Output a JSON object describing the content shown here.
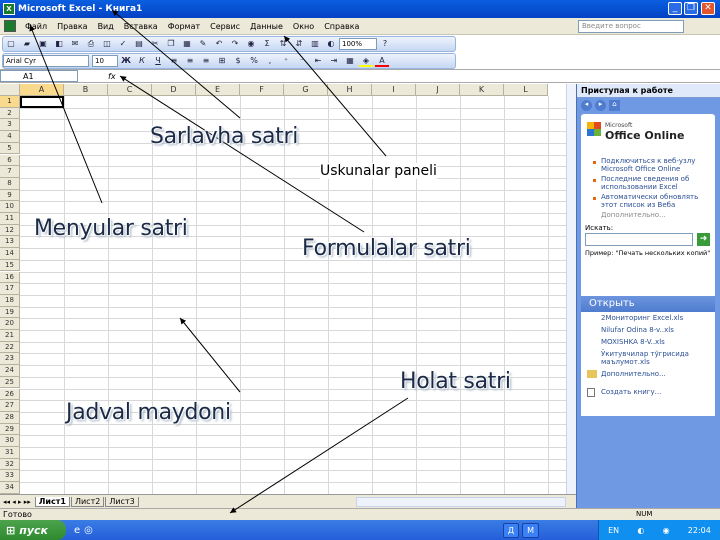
{
  "window": {
    "title": "Microsoft Excel - Книга1"
  },
  "menu": {
    "items": [
      "Файл",
      "Правка",
      "Вид",
      "Вставка",
      "Формат",
      "Сервис",
      "Данные",
      "Окно",
      "Справка"
    ],
    "ask_placeholder": "Введите вопрос"
  },
  "formatting": {
    "font": "Arial Cyr",
    "size": "10",
    "zoom": "100%"
  },
  "formula_bar": {
    "cell": "A1",
    "fx": "fx"
  },
  "grid": {
    "columns": [
      "A",
      "B",
      "C",
      "D",
      "E",
      "F",
      "G",
      "H",
      "I",
      "J",
      "K",
      "L"
    ],
    "rows": [
      "1",
      "2",
      "3",
      "4",
      "5",
      "6",
      "7",
      "8",
      "9",
      "10",
      "11",
      "12",
      "13",
      "14",
      "15",
      "16",
      "17",
      "18",
      "19",
      "20",
      "21",
      "22",
      "23",
      "24",
      "25",
      "26",
      "27",
      "28",
      "29",
      "30",
      "31",
      "32",
      "33",
      "34"
    ]
  },
  "sheets": {
    "tabs": [
      "Лист1",
      "Лист2",
      "Лист3"
    ]
  },
  "status": {
    "ready": "Готово",
    "num": "NUM"
  },
  "taskpane": {
    "title": "Приступая к работе",
    "office_online": "Office Online",
    "microsoft": "Microsoft",
    "links": [
      "Подключиться к веб-узлу Microsoft Office Online",
      "Последние сведения об использовании Excel",
      "Автоматически обновлять этот список из Веба"
    ],
    "more": "Дополнительно...",
    "search_label": "Искать:",
    "example": "Пример: \"Печать нескольких копий\"",
    "open_header": "Открыть",
    "files": [
      "2Мониторинг Excel.xls",
      "Nilufar Odina 8-v..xls",
      "MOXISHKA  8-V..xls",
      "Ўкитувчилар тўгрисида маълумот.xls"
    ],
    "open_more": "Дополнительно...",
    "create": "Создать книгу..."
  },
  "taskbar": {
    "start": "пуск",
    "tasks": [
      "Д",
      "М"
    ],
    "lang": "EN",
    "time": "22:04"
  },
  "annotations": {
    "title_row": "Sarlavha satri",
    "toolbar": "Uskunalar paneli",
    "menu_row": "Menyular satri",
    "formula_row": "Formulalar satri",
    "table_area": "Jadval maydoni",
    "status_row": "Holat satri"
  }
}
